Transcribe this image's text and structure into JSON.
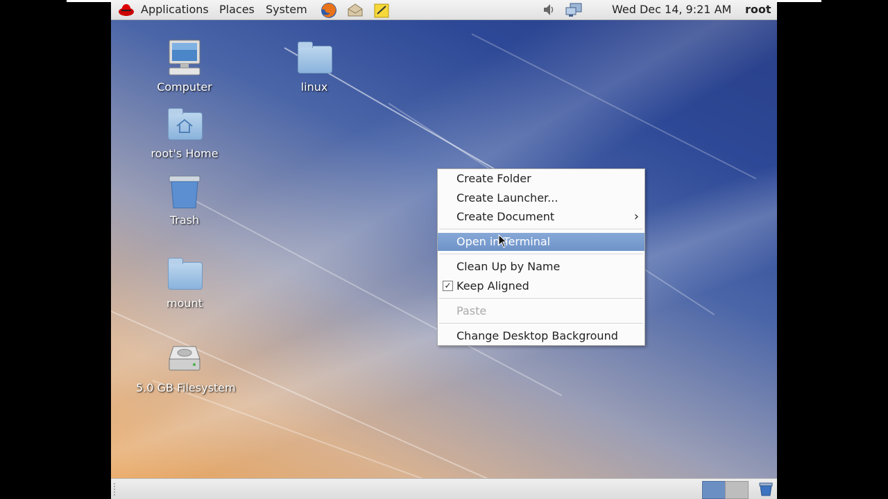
{
  "top_panel": {
    "menus": [
      "Applications",
      "Places",
      "System"
    ],
    "clock": "Wed Dec 14,  9:21 AM",
    "user": "root"
  },
  "desktop_icons": [
    {
      "label": "Computer",
      "icon": "computer-icon"
    },
    {
      "label": "linux",
      "icon": "folder-icon"
    },
    {
      "label": "root's Home",
      "icon": "home-folder-icon"
    },
    {
      "label": "Trash",
      "icon": "trash-icon"
    },
    {
      "label": "mount",
      "icon": "folder-icon"
    },
    {
      "label": "5.0 GB Filesystem",
      "icon": "drive-icon"
    }
  ],
  "context_menu": {
    "items": [
      {
        "label": "Create Folder",
        "state": "normal"
      },
      {
        "label": "Create Launcher...",
        "state": "normal"
      },
      {
        "label": "Create Document",
        "state": "normal",
        "submenu": true
      },
      {
        "label": "Open in Terminal",
        "state": "highlighted"
      },
      {
        "label": "Clean Up by Name",
        "state": "normal"
      },
      {
        "label": "Keep Aligned",
        "state": "checked"
      },
      {
        "label": "Paste",
        "state": "disabled"
      },
      {
        "label": "Change Desktop Background",
        "state": "normal"
      }
    ]
  },
  "colors": {
    "highlight": "#7a9dd0",
    "panel": "#e8e8e8"
  }
}
